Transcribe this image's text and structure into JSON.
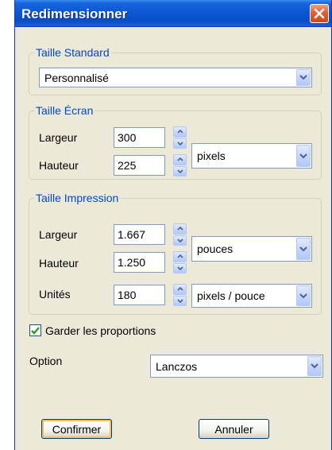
{
  "window": {
    "title": "Redimensionner"
  },
  "standard": {
    "legend": "Taille Standard",
    "preset": "Personnalisé"
  },
  "ecran": {
    "legend": "Taille Écran",
    "width_label": "Largeur",
    "width_value": "300",
    "height_label": "Hauteur",
    "height_value": "225",
    "unit": "pixels"
  },
  "impression": {
    "legend": "Taille Impression",
    "width_label": "Largeur",
    "width_value": "1.667",
    "height_label": "Hauteur",
    "height_value": "1.250",
    "unit": "pouces",
    "units_label": "Unités",
    "units_value": "180",
    "resolution_unit": "pixels / pouce"
  },
  "keep_proportions": {
    "label": "Garder les proportions",
    "checked": true
  },
  "option": {
    "label": "Option",
    "value": "Lanczos"
  },
  "buttons": {
    "confirm": "Confirmer",
    "cancel": "Annuler"
  },
  "icons": {
    "close": "close-icon",
    "dropdown": "chevron-down-icon",
    "spin_up": "spin-up-icon",
    "spin_down": "spin-down-icon",
    "check": "checkmark-icon"
  },
  "colors": {
    "titlebar": "#0b55d3",
    "close_button": "#e0602f",
    "legend_text": "#0046d5",
    "dialog_bg": "#ece9d8",
    "check": "#21a121"
  }
}
